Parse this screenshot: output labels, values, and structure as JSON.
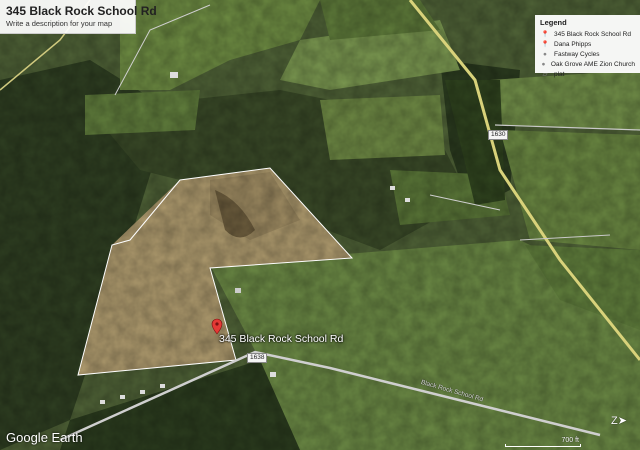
{
  "map": {
    "title": "345 Black Rock School Rd",
    "description": "Write a description for your map",
    "place_label": "345 Black Rock School Rd",
    "road_shield_main": "1638",
    "road_shield_right": "1630",
    "road_name": "Black Rock School Rd",
    "logo": "Google Earth",
    "scale_label": "700 ft",
    "compass_icon": "compass-icon"
  },
  "legend": {
    "heading": "Legend",
    "items": [
      {
        "label": "345 Black Rock School Rd",
        "icon": "pin-icon",
        "color": "#e53935"
      },
      {
        "label": "Dana Phipps",
        "icon": "pin-icon",
        "color": "#e53935"
      },
      {
        "label": "Fastway Cycles",
        "icon": "pin-icon",
        "color": "#888888"
      },
      {
        "label": "Oak Grove AME Zion Church",
        "icon": "pin-icon",
        "color": "#888888"
      },
      {
        "label": "plat",
        "icon": "polygon-icon",
        "color": "#888888"
      }
    ]
  },
  "colors": {
    "pin": "#e53935",
    "boundary": "#ffffff",
    "field": "#6d8a3f",
    "forest": "#2d3f1f",
    "cleared_land": "#b3a073",
    "road": "#c9c9c9",
    "highway": "#d6d27a"
  }
}
